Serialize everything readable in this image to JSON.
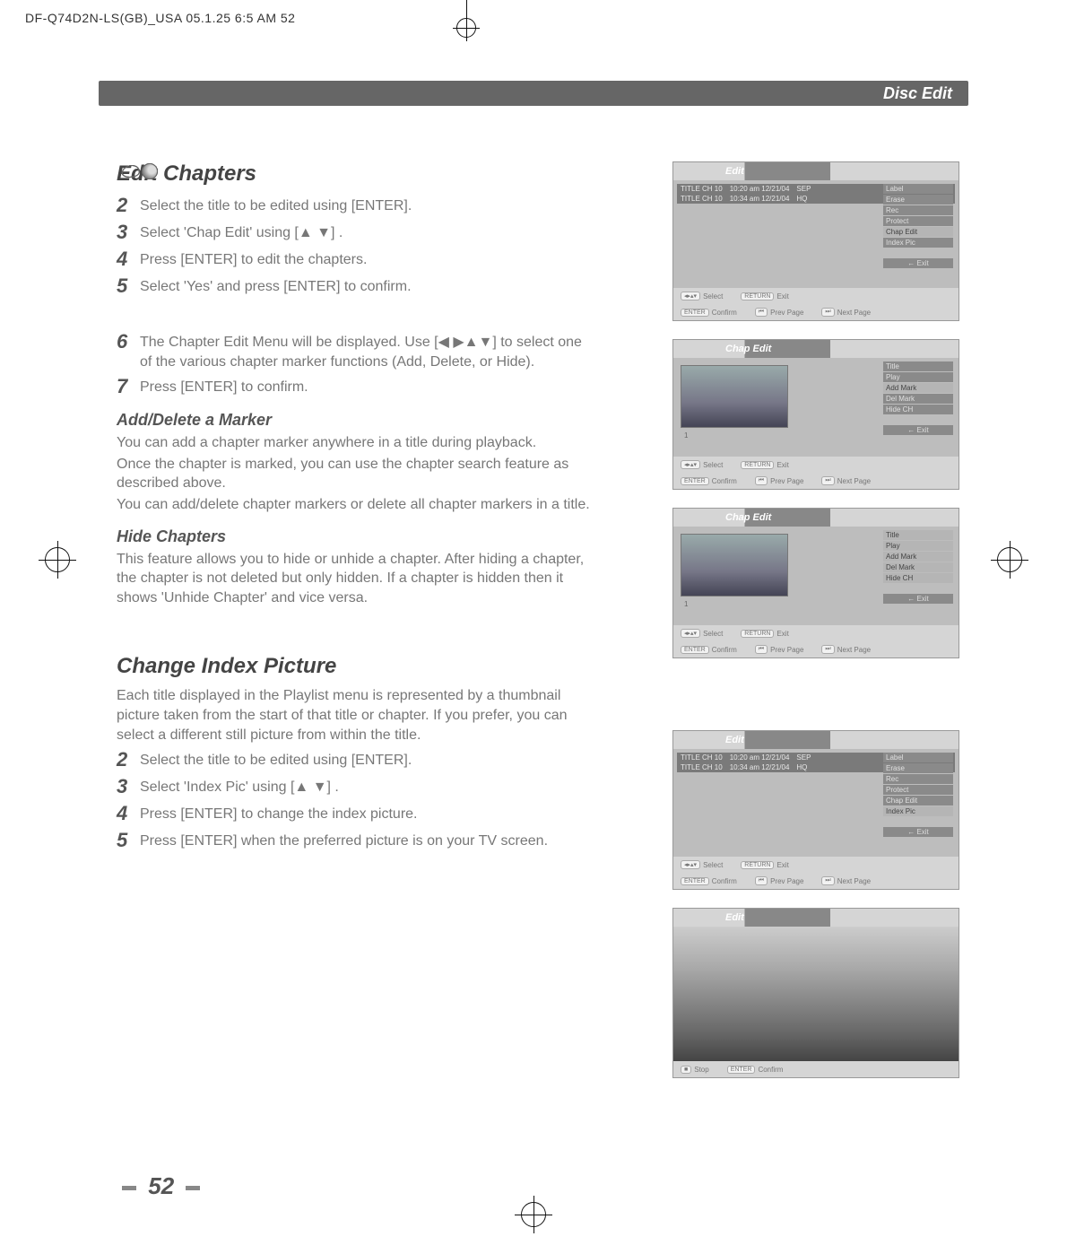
{
  "print_header": "DF-Q74D2N-LS(GB)_USA  05.1.25 6:5 AM      52",
  "section_header": "Disc Edit",
  "page_number": "52",
  "edit_chapters": {
    "title": "Edit Chapters",
    "steps": [
      {
        "num": "2",
        "text": "Select the title to be edited using [ENTER]."
      },
      {
        "num": "3",
        "text": "Select 'Chap Edit' using [▲ ▼] ."
      },
      {
        "num": "4",
        "text": "Press [ENTER] to edit the chapters."
      },
      {
        "num": "5",
        "text": "Select 'Yes'  and press [ENTER] to confirm."
      },
      {
        "num": "6",
        "text": "The Chapter Edit Menu will be displayed. Use [◀ ▶▲▼] to select one of the various chapter marker functions (Add, Delete, or Hide)."
      },
      {
        "num": "7",
        "text": "Press [ENTER] to confirm."
      }
    ],
    "add_delete": {
      "heading": "Add/Delete a Marker",
      "p1": "You can add a chapter marker anywhere in a title during playback.",
      "p2": "Once the chapter is marked, you can use the chapter search feature as described above.",
      "p3": "You can add/delete chapter markers or delete all chapter markers in a title."
    },
    "hide": {
      "heading": "Hide Chapters",
      "p1": "This feature allows you to hide or unhide a chapter. After hiding a chapter, the chapter is not deleted but only hidden. If a chapter is hidden then it shows 'Unhide Chapter' and vice versa."
    }
  },
  "change_index": {
    "title": "Change Index Picture",
    "intro": "Each title displayed in the Playlist menu is represented by a thumbnail picture taken from the start of that title or chapter. If you prefer, you can select a different still picture from within the title.",
    "steps": [
      {
        "num": "2",
        "text": "Select the title to be edited using [ENTER]."
      },
      {
        "num": "3",
        "text": "Select 'Index Pic' using [▲ ▼] ."
      },
      {
        "num": "4",
        "text": "Press [ENTER] to change the index picture."
      },
      {
        "num": "5",
        "text": "Press [ENTER] when the preferred picture is on your TV screen."
      }
    ]
  },
  "panels": {
    "edit1": {
      "header": "Edit",
      "rows": [
        {
          "title": "TITLE CH 10",
          "time": "10:20 am 12/21/04",
          "qual": "SEP"
        },
        {
          "title": "TITLE CH 10",
          "time": "10:34 am 12/21/04",
          "qual": "HQ"
        }
      ],
      "menu": [
        "Label",
        "Erase",
        "Rec",
        "Protect",
        "Chap Edit",
        "Index Pic"
      ],
      "highlight": "Chap Edit",
      "exit": "←   Exit",
      "footer": {
        "select": "Select",
        "confirm": "Confirm",
        "exitkey": "Exit",
        "prev": "Prev Page",
        "next": "Next Page"
      }
    },
    "chap1": {
      "header": "Chap Edit",
      "preview_num": "1",
      "menu": [
        "Title",
        "Play",
        "Add Mark",
        "Del Mark",
        "Hide CH"
      ],
      "highlight": "Add Mark",
      "exit": "←   Exit",
      "footer": {
        "select": "Select",
        "confirm": "Confirm",
        "exitkey": "Exit",
        "prev": "Prev Page",
        "next": "Next Page"
      }
    },
    "chap2": {
      "header": "Chap Edit",
      "preview_num": "1",
      "menu": [
        "Title",
        "Play",
        "Add Mark",
        "Del Mark",
        "Hide CH"
      ],
      "highlight": "",
      "exit": "←   Exit",
      "footer": {
        "select": "Select",
        "confirm": "Confirm",
        "exitkey": "Exit",
        "prev": "Prev Page",
        "next": "Next Page"
      }
    },
    "edit2": {
      "header": "Edit",
      "rows": [
        {
          "title": "TITLE CH 10",
          "time": "10:20 am 12/21/04",
          "qual": "SEP"
        },
        {
          "title": "TITLE CH 10",
          "time": "10:34 am 12/21/04",
          "qual": "HQ"
        }
      ],
      "menu": [
        "Label",
        "Erase",
        "Rec",
        "Protect",
        "Chap Edit",
        "Index Pic"
      ],
      "highlight": "Index Pic",
      "exit": "←   Exit",
      "footer": {
        "select": "Select",
        "confirm": "Confirm",
        "exitkey": "Exit",
        "prev": "Prev Page",
        "next": "Next Page"
      }
    },
    "edit3": {
      "header": "Edit",
      "footer": {
        "stop": "Stop",
        "confirm": "Confirm"
      }
    }
  }
}
